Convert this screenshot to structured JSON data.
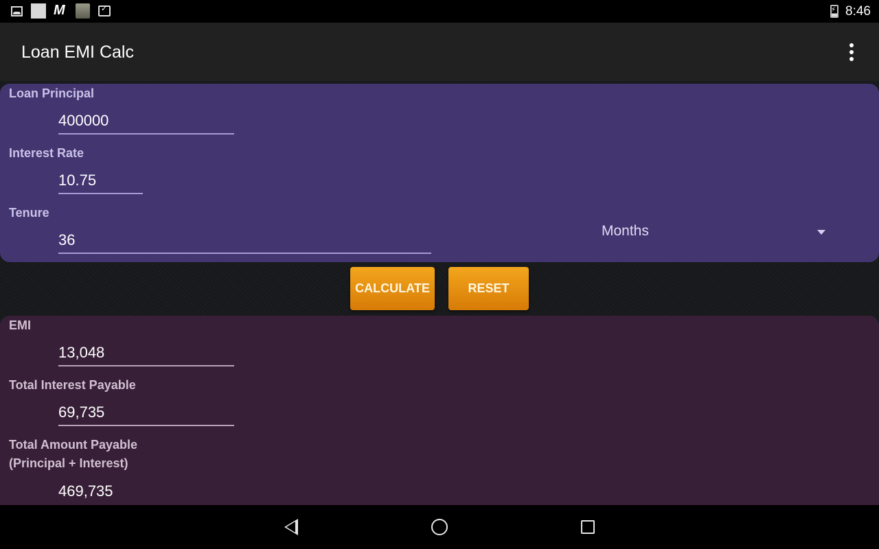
{
  "status_bar": {
    "icons": [
      "gallery-icon",
      "blank-notification-icon",
      "m-app-icon",
      "talking-cat-icon",
      "task-icon",
      "battery-charging-icon"
    ],
    "time": "8:46"
  },
  "app_bar": {
    "title": "Loan EMI Calc",
    "overflow_icon": "more-vert-icon"
  },
  "inputs": {
    "principal": {
      "label": "Loan Principal",
      "value": "400000"
    },
    "interest_rate": {
      "label": "Interest Rate",
      "value": "10.75"
    },
    "tenure": {
      "label": "Tenure",
      "value": "36",
      "unit_selected": "Months"
    }
  },
  "buttons": {
    "calculate": "CALCULATE",
    "reset": "RESET"
  },
  "results": {
    "emi": {
      "label": "EMI",
      "value": "13,048"
    },
    "total_interest": {
      "label": "Total Interest Payable",
      "value": "69,735"
    },
    "total_amount": {
      "label_line1": "Total Amount Payable",
      "label_line2": "(Principal + Interest)",
      "value": "469,735"
    }
  },
  "nav_bar": {
    "back": "back-icon",
    "home": "home-icon",
    "recents": "recents-icon"
  },
  "colors": {
    "input_card": "#423570",
    "output_card": "#371f37",
    "button": "#e98f12",
    "app_bar": "#212121"
  }
}
